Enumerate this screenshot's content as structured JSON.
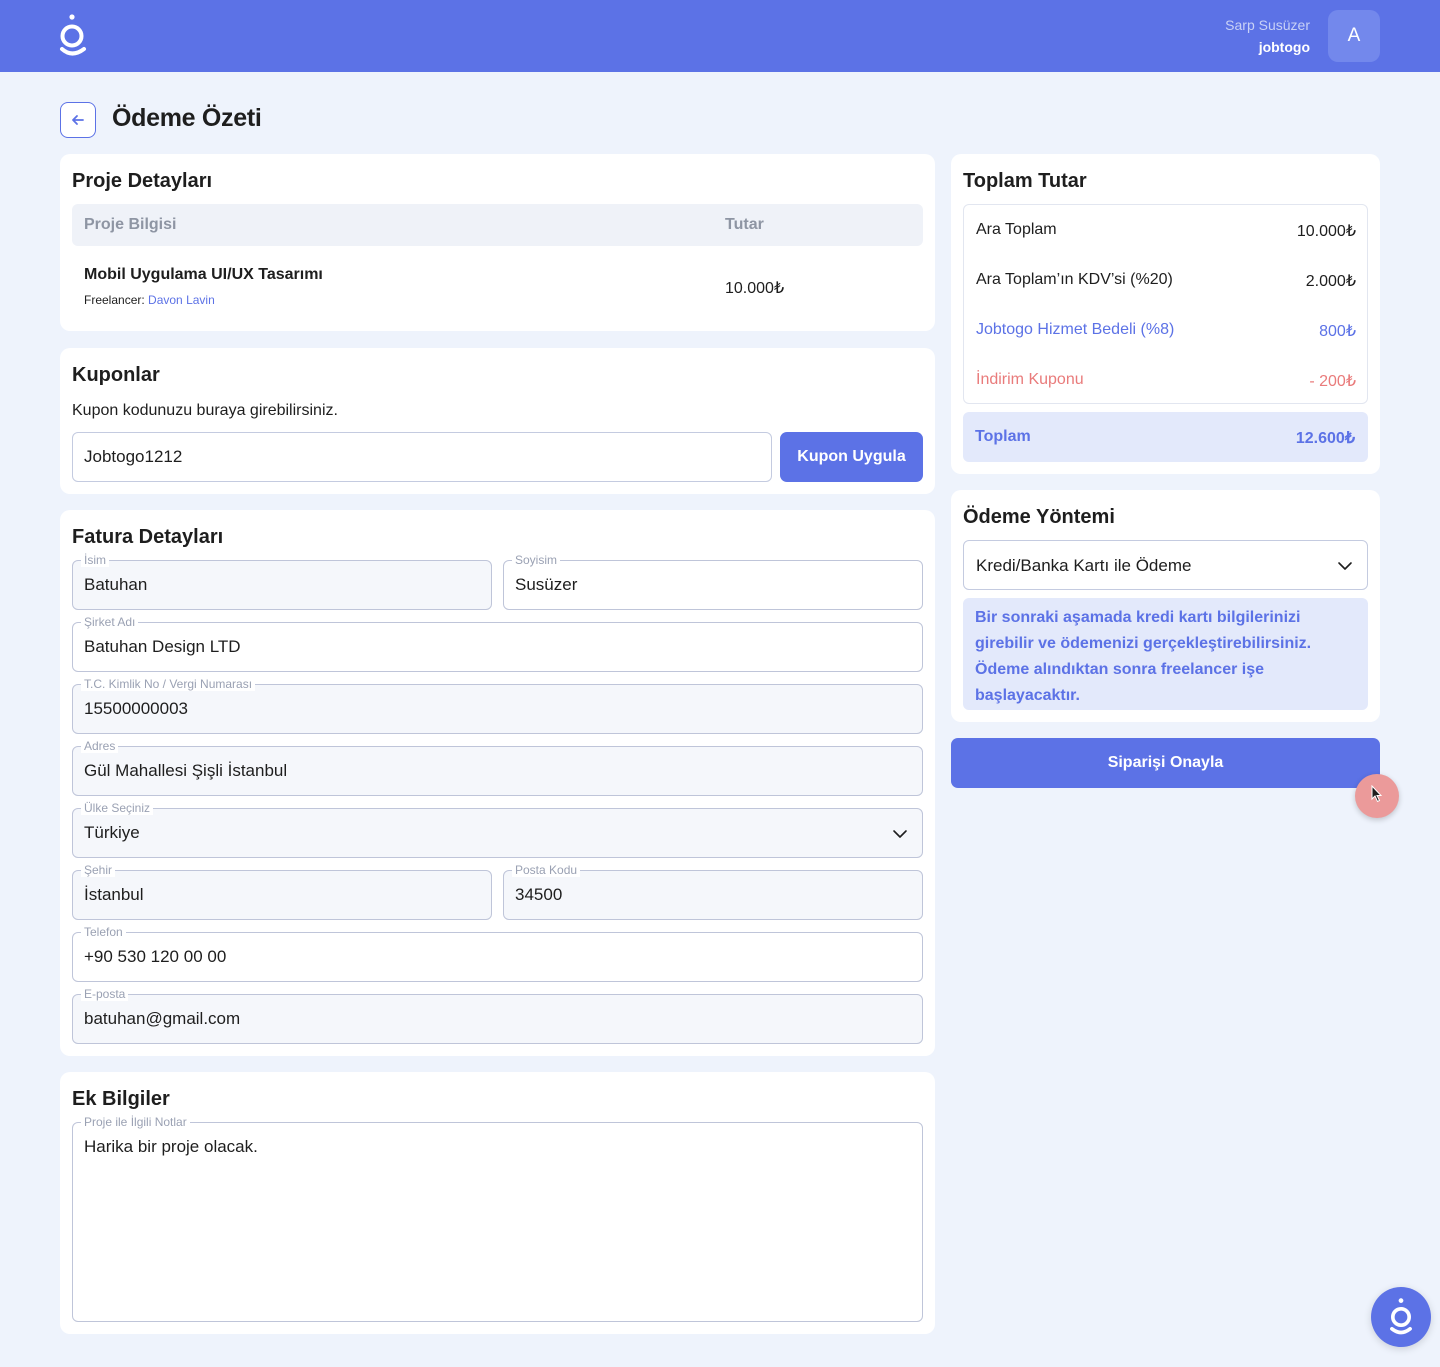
{
  "header": {
    "user_name": "Sarp Susüzer",
    "org_name": "jobtogo",
    "avatar_initial": "A"
  },
  "page": {
    "title": "Ödeme Özeti"
  },
  "project": {
    "title": "Proje Detayları",
    "col_info": "Proje Bilgisi",
    "col_amount": "Tutar",
    "name": "Mobil Uygulama UI/UX Tasarımı",
    "freelancer_label": "Freelancer:",
    "freelancer_name": "Davon Lavin",
    "amount": "10.000₺"
  },
  "coupons": {
    "title": "Kuponlar",
    "hint": "Kupon kodunuzu buraya girebilirsiniz.",
    "code": "Jobtogo1212",
    "apply_label": "Kupon Uygula"
  },
  "invoice": {
    "title": "Fatura Detayları",
    "fields": {
      "first_name": {
        "label": "İsim",
        "value": "Batuhan"
      },
      "last_name": {
        "label": "Soyisim",
        "value": "Susüzer"
      },
      "company": {
        "label": "Şirket Adı",
        "value": "Batuhan Design LTD"
      },
      "tax_id": {
        "label": "T.C. Kimlik No / Vergi Numarası",
        "value": "15500000003"
      },
      "address": {
        "label": "Adres",
        "value": "Gül Mahallesi Şişli İstanbul"
      },
      "country": {
        "label": "Ülke Seçiniz",
        "value": "Türkiye"
      },
      "city": {
        "label": "Şehir",
        "value": "İstanbul"
      },
      "postal": {
        "label": "Posta Kodu",
        "value": "34500"
      },
      "phone": {
        "label": "Telefon",
        "value": "+90 530 120 00 00"
      },
      "email": {
        "label": "E-posta",
        "value": "batuhan@gmail.com"
      }
    }
  },
  "extra": {
    "title": "Ek Bilgiler",
    "notes_label": "Proje ile İlgili Notlar",
    "notes_value": "Harika bir proje olacak."
  },
  "totals": {
    "title": "Toplam Tutar",
    "subtotal_label": "Ara Toplam",
    "subtotal_value": "10.000₺",
    "vat_label": "Ara Toplam’ın KDV’si (%20)",
    "vat_value": "2.000₺",
    "fee_label": "Jobtogo Hizmet Bedeli (%8)",
    "fee_value": "800₺",
    "discount_label": "İndirim Kuponu",
    "discount_value": "- 200₺",
    "total_label": "Toplam",
    "total_value": "12.600₺"
  },
  "payment": {
    "title": "Ödeme Yöntemi",
    "method": "Kredi/Banka Kartı ile Ödeme",
    "info": "Bir sonraki aşamada kredi kartı bilgilerinizi girebilir ve ödemenizi gerçekleştirebilirsiniz. Ödeme alındıktan sonra freelancer işe başlayacaktır.",
    "confirm_label": "Siparişi Onayla"
  },
  "colors": {
    "primary": "#5c72e6",
    "discount": "#e97b7b",
    "background": "#eef3fc"
  }
}
